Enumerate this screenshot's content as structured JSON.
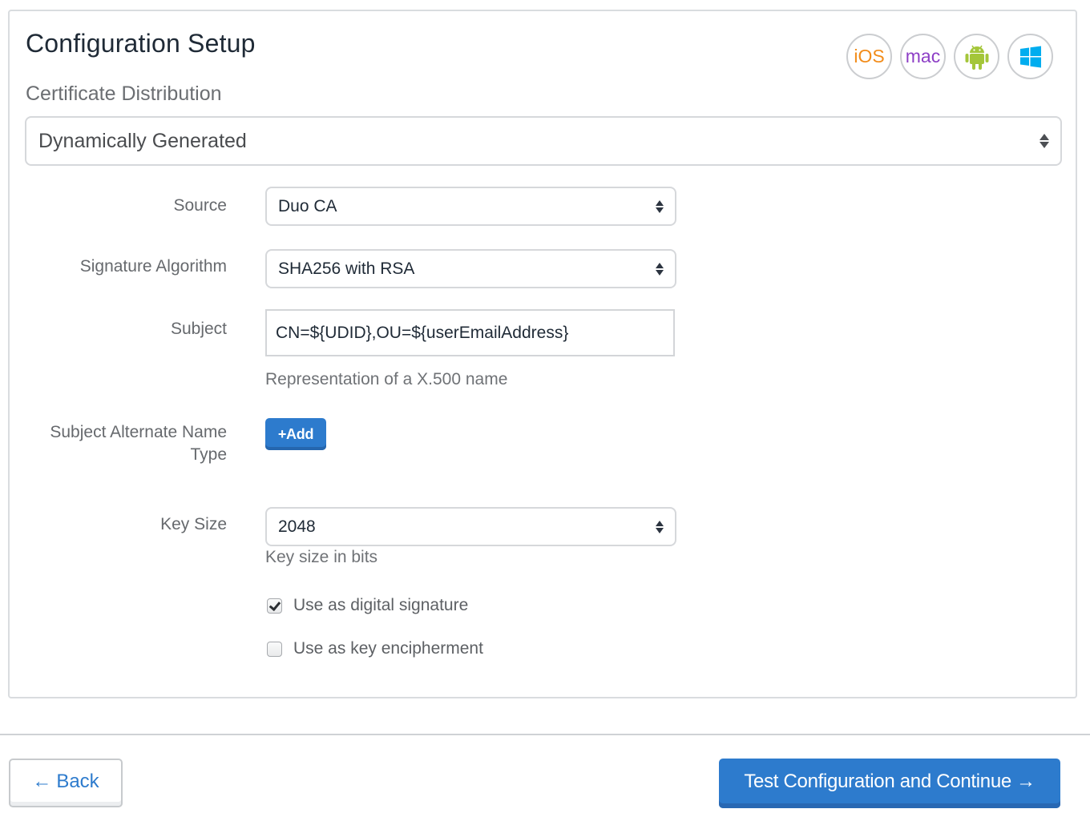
{
  "header": {
    "title": "Configuration Setup",
    "section_label": "Certificate Distribution"
  },
  "platforms": [
    {
      "name": "ios",
      "label": "iOS",
      "color": "#f28c1a",
      "icon": "ios-icon"
    },
    {
      "name": "mac",
      "label": "mac",
      "color": "#8d3fc6",
      "icon": "mac-icon"
    },
    {
      "name": "android",
      "label": "",
      "color": "#a4c639",
      "icon": "android-icon"
    },
    {
      "name": "windows",
      "label": "",
      "color": "#00adef",
      "icon": "windows-icon"
    }
  ],
  "distribution": {
    "selected": "Dynamically Generated"
  },
  "form": {
    "source": {
      "label": "Source",
      "value": "Duo CA"
    },
    "signature_algorithm": {
      "label": "Signature Algorithm",
      "value": "SHA256 with RSA"
    },
    "subject": {
      "label": "Subject",
      "value": "CN=${UDID},OU=${userEmailAddress}",
      "help": "Representation of a X.500 name"
    },
    "san_type": {
      "label_line1": "Subject Alternate Name",
      "label_line2": "Type",
      "add_button": "+Add"
    },
    "key_size": {
      "label": "Key Size",
      "value": "2048",
      "help": "Key size in bits"
    },
    "checkboxes": [
      {
        "label": "Use as digital signature",
        "checked": true
      },
      {
        "label": "Use as key encipherment",
        "checked": false
      }
    ]
  },
  "footer": {
    "back_label": "Back",
    "back_arrow": "←",
    "next_label": "Test Configuration and Continue",
    "next_arrow": "→"
  },
  "colors": {
    "primary": "#2d7bcd",
    "android": "#a4c639",
    "windows": "#00adef"
  }
}
